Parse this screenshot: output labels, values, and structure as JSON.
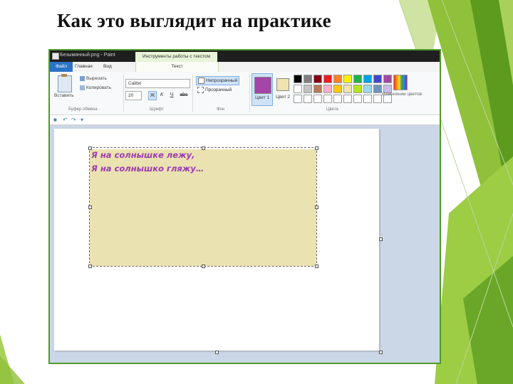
{
  "slide": {
    "title": "Как это выглядит на практике"
  },
  "window": {
    "title": "Безымянный.png - Paint",
    "context_tab_header": "Инструменты работы с текстом"
  },
  "tabs": [
    {
      "label": "Файл"
    },
    {
      "label": "Главная"
    },
    {
      "label": "Вид"
    },
    {
      "label": "Текст"
    }
  ],
  "clipboard": {
    "paste_label": "Вставить",
    "cut_label": "Вырезать",
    "copy_label": "Копировать",
    "group_label": "Буфер обмена"
  },
  "font": {
    "family": "Calibri",
    "size": "20",
    "bold": "Ж",
    "italic": "К",
    "underline": "Ч",
    "strike": "abc",
    "group_label": "Шрифт"
  },
  "background": {
    "opaque_label": "Непрозрачный",
    "transparent_label": "Прозрачный",
    "group_label": "Фон"
  },
  "colors": {
    "color1_label": "Цвет 1",
    "color2_label": "Цвет 2",
    "color1_value": "#a346a8",
    "color2_value": "#efe4b0",
    "edit_colors_label": "Изменение цветов",
    "group_label": "Цвета",
    "palette_row1": [
      "#000000",
      "#7f7f7f",
      "#880015",
      "#ed1c24",
      "#ff7f27",
      "#fff200",
      "#22b14c",
      "#00a2e8",
      "#3f48cc",
      "#a349a4"
    ],
    "palette_row2": [
      "#ffffff",
      "#c3c3c3",
      "#b97a57",
      "#ffaec9",
      "#ffc90e",
      "#efe4b0",
      "#b5e61d",
      "#99d9ea",
      "#7092be",
      "#c8bfe7"
    ],
    "palette_row3": [
      "#ffffff",
      "#ffffff",
      "#ffffff",
      "#ffffff",
      "#ffffff",
      "#ffffff",
      "#ffffff",
      "#ffffff",
      "#ffffff",
      "#ffffff"
    ]
  },
  "canvas": {
    "text_line1": "Я на солнышке лежу,",
    "text_line2": "Я на солнышко гляжу…",
    "text_color": "#9b3bb0",
    "text_background": "#ebe2b1"
  }
}
